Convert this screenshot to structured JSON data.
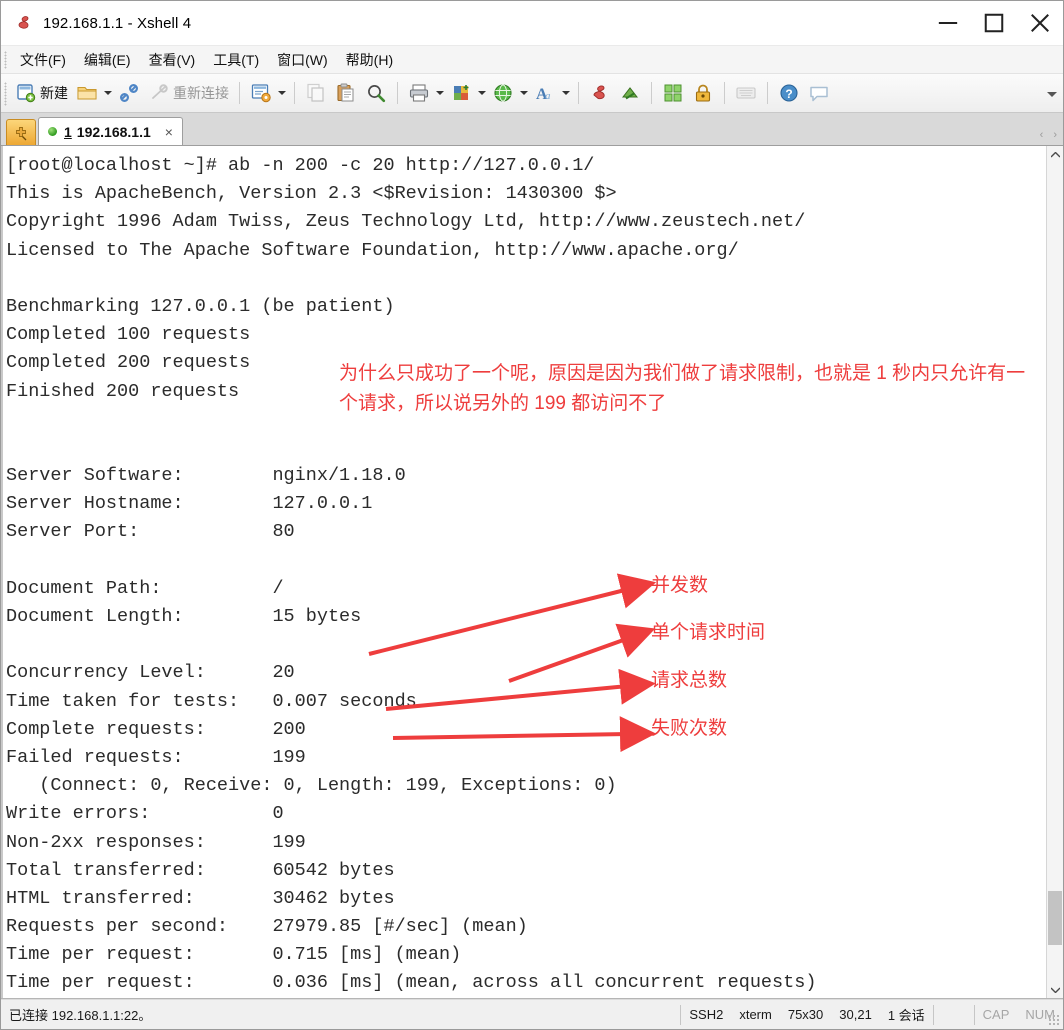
{
  "window": {
    "title": "192.168.1.1 - Xshell 4",
    "icon": "xshell-app-icon",
    "minimize": "—",
    "maximize": "□",
    "close": "✕"
  },
  "menubar": {
    "items": [
      {
        "label": "文件(F)",
        "name": "menu-file"
      },
      {
        "label": "编辑(E)",
        "name": "menu-edit"
      },
      {
        "label": "查看(V)",
        "name": "menu-view"
      },
      {
        "label": "工具(T)",
        "name": "menu-tools"
      },
      {
        "label": "窗口(W)",
        "name": "menu-window"
      },
      {
        "label": "帮助(H)",
        "name": "menu-help"
      }
    ]
  },
  "toolbar": {
    "new_label": "新建",
    "reconnect_label": "重新连接",
    "overflow_label": "▾"
  },
  "tabbar": {
    "new_tab_icon": "new-session-icon",
    "tab": {
      "number": "1",
      "title": "192.168.1.1",
      "close": "×",
      "status": "connected"
    },
    "scroll_left": "‹",
    "scroll_right": "›"
  },
  "terminal": {
    "lines": [
      "[root@localhost ~]# ab -n 200 -c 20 http://127.0.0.1/",
      "This is ApacheBench, Version 2.3 <$Revision: 1430300 $>",
      "Copyright 1996 Adam Twiss, Zeus Technology Ltd, http://www.zeustech.net/",
      "Licensed to The Apache Software Foundation, http://www.apache.org/",
      "",
      "Benchmarking 127.0.0.1 (be patient)",
      "Completed 100 requests",
      "Completed 200 requests",
      "Finished 200 requests",
      "",
      "",
      "Server Software:        nginx/1.18.0",
      "Server Hostname:        127.0.0.1",
      "Server Port:            80",
      "",
      "Document Path:          /",
      "Document Length:        15 bytes",
      "",
      "Concurrency Level:      20",
      "Time taken for tests:   0.007 seconds",
      "Complete requests:      200",
      "Failed requests:        199",
      "   (Connect: 0, Receive: 0, Length: 199, Exceptions: 0)",
      "Write errors:           0",
      "Non-2xx responses:      199",
      "Total transferred:      60542 bytes",
      "HTML transferred:       30462 bytes",
      "Requests per second:    27979.85 [#/sec] (mean)",
      "Time per request:       0.715 [ms] (mean)",
      "Time per request:       0.036 [ms] (mean, across all concurrent requests)"
    ]
  },
  "annotations": {
    "color": "#ee3d3d",
    "paragraph": "为什么只成功了一个呢，原因是因为我们做了请求限制，也就是 1 秒内只允许有一个请求，所以说另外的 199 都访问不了",
    "labels": [
      {
        "text": "并发数",
        "name": "annotation-concurrency"
      },
      {
        "text": "单个请求时间",
        "name": "annotation-single-request-time"
      },
      {
        "text": "请求总数",
        "name": "annotation-total-requests"
      },
      {
        "text": "失败次数",
        "name": "annotation-failed-count"
      }
    ]
  },
  "statusbar": {
    "connection": "已连接 192.168.1.1:22。",
    "protocol": "SSH2",
    "term_type": "xterm",
    "size": "75x30",
    "cursor": "30,21",
    "sessions": "1 会话",
    "cap": "CAP",
    "num": "NUM"
  }
}
